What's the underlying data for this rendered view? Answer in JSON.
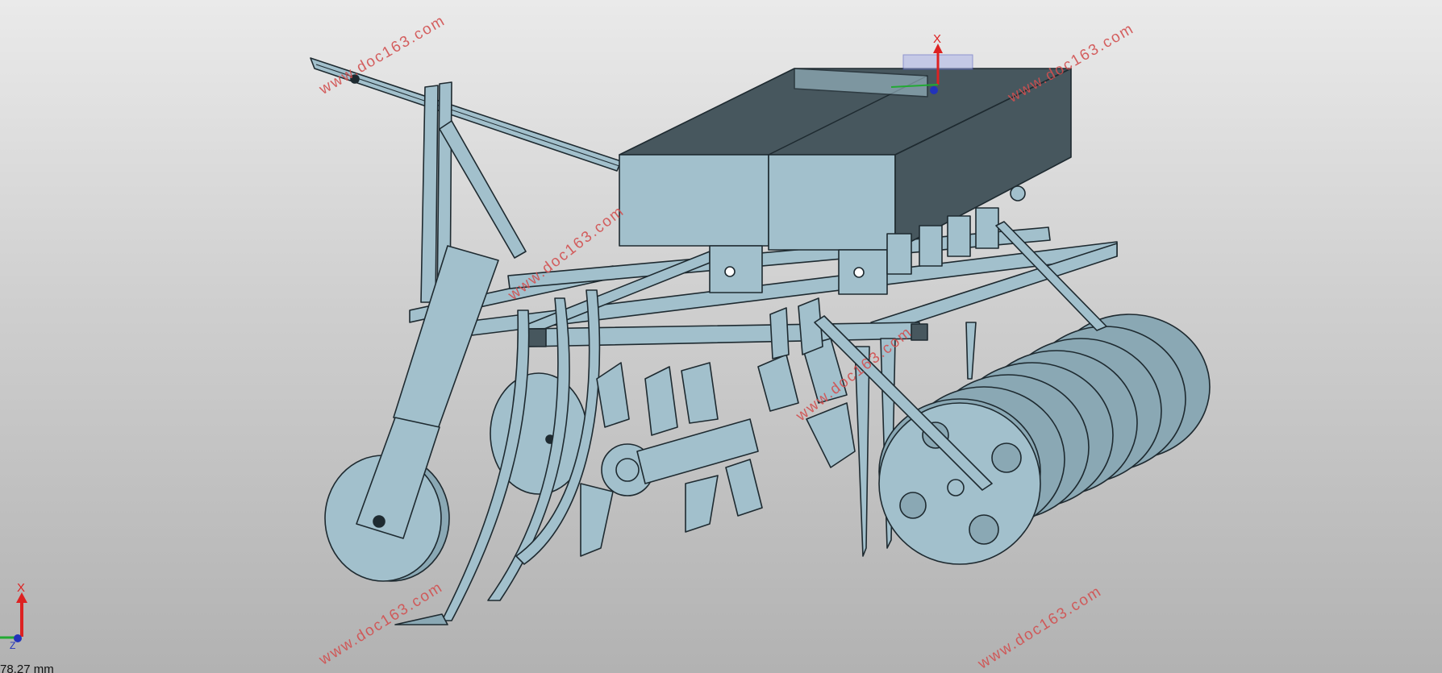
{
  "viewport": {
    "scale_readout": "78.27 mm"
  },
  "triad": {
    "axis_x_label": "X",
    "axis_z_label": "Z"
  },
  "origin_triad": {
    "axis_x_label": "X"
  },
  "watermarks": [
    "www.doc163.com",
    "www.doc163.com",
    "www.doc163.com",
    "www.doc163.com",
    "www.doc163.com",
    "www.doc163.com"
  ],
  "colors": {
    "body_fill": "#a2c0cc",
    "shade_fill": "#47575e",
    "edge": "#1e2a30",
    "watermark": "#d25050",
    "axis_red": "#dd2222",
    "axis_green": "#22aa33",
    "axis_blue": "#2233bb"
  }
}
